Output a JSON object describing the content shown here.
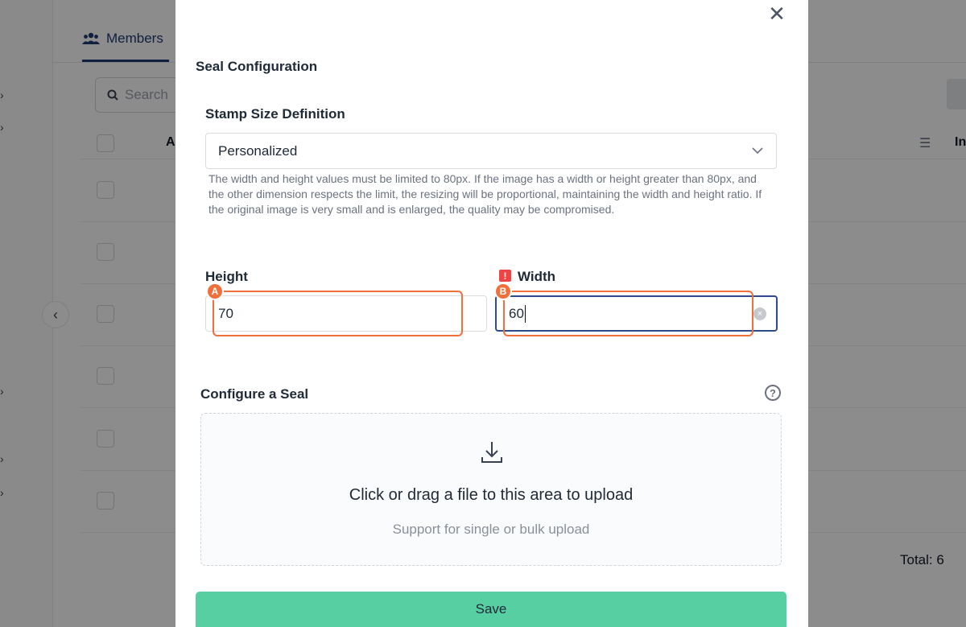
{
  "background": {
    "tab_label": "Members",
    "search_placeholder": "Search",
    "column_a": "A",
    "column_in": "In",
    "total": "Total: 6"
  },
  "modal": {
    "title": "Seal Configuration",
    "stamp_size": {
      "label": "Stamp Size Definition",
      "selected": "Personalized",
      "help": "The width and height values must be limited to 80px. If the image has a width or height greater than 80px, and the other dimension respects the limit, the resizing will be proportional, maintaining the width and height ratio. If the original image is very small and is enlarged, the quality may be compromised."
    },
    "height": {
      "label": "Height",
      "value": "70",
      "marker": "A"
    },
    "width": {
      "label": "Width",
      "value": "60",
      "marker": "B",
      "error_badge": "!"
    },
    "seal": {
      "label": "Configure a Seal",
      "help_icon": "?",
      "upload_text": "Click or drag a file to this area to upload",
      "upload_hint": "Support for single or bulk upload"
    },
    "save_label": "Save"
  }
}
